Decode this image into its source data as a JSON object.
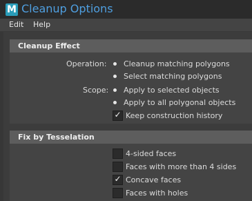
{
  "window": {
    "title": "Cleanup Options",
    "app_icon_letter": "M"
  },
  "menu": {
    "items": [
      "Edit",
      "Help"
    ]
  },
  "cleanup_effect": {
    "title": "Cleanup Effect",
    "operation_label": "Operation:",
    "operation_options": [
      "Cleanup matching polygons",
      "Select matching polygons"
    ],
    "operation_selected": 0,
    "scope_label": "Scope:",
    "scope_options": [
      "Apply to selected objects",
      "Apply to all polygonal objects"
    ],
    "scope_selected": 0,
    "history_label": "Keep construction history",
    "history_checked": true
  },
  "fix_by_tesselation": {
    "title": "Fix by Tesselation",
    "options": [
      {
        "label": "4-sided faces",
        "checked": false
      },
      {
        "label": "Faces with more than 4 sides",
        "checked": false
      },
      {
        "label": "Concave faces",
        "checked": true
      },
      {
        "label": "Faces with holes",
        "checked": false
      }
    ]
  },
  "icons": {
    "check": "checkmark-icon",
    "radio": "radio-dot-icon"
  }
}
